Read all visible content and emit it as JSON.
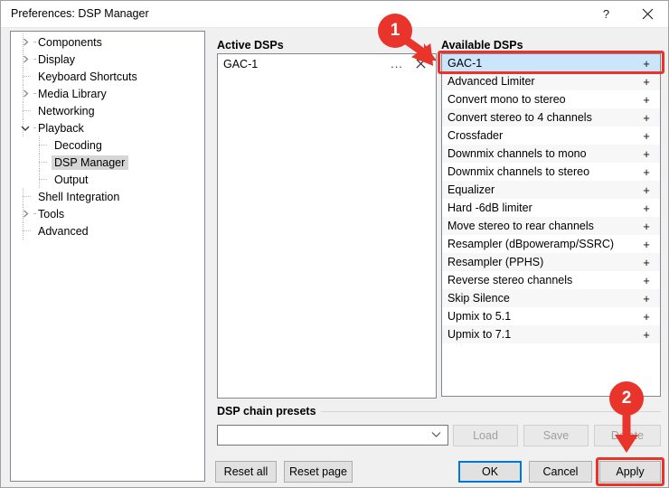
{
  "window": {
    "title": "Preferences: DSP Manager",
    "help_icon": "question-mark-icon",
    "help_label": "?",
    "close_icon": "close-icon"
  },
  "sidebar": {
    "items": [
      {
        "label": "Components",
        "level": 0,
        "marker": "collapsed",
        "selected": false
      },
      {
        "label": "Display",
        "level": 0,
        "marker": "collapsed",
        "selected": false
      },
      {
        "label": "Keyboard Shortcuts",
        "level": 0,
        "marker": "leaf",
        "selected": false
      },
      {
        "label": "Media Library",
        "level": 0,
        "marker": "collapsed",
        "selected": false
      },
      {
        "label": "Networking",
        "level": 0,
        "marker": "leaf",
        "selected": false
      },
      {
        "label": "Playback",
        "level": 0,
        "marker": "expanded",
        "selected": false
      },
      {
        "label": "Decoding",
        "level": 1,
        "marker": "leaf",
        "selected": false
      },
      {
        "label": "DSP Manager",
        "level": 1,
        "marker": "leaf",
        "selected": true
      },
      {
        "label": "Output",
        "level": 1,
        "marker": "leaf",
        "selected": false
      },
      {
        "label": "Shell Integration",
        "level": 0,
        "marker": "leaf",
        "selected": false
      },
      {
        "label": "Tools",
        "level": 0,
        "marker": "collapsed",
        "selected": false
      },
      {
        "label": "Advanced",
        "level": 0,
        "marker": "leaf",
        "selected": false
      }
    ]
  },
  "active_dsps": {
    "heading": "Active DSPs",
    "rows": [
      {
        "label": "GAC-1",
        "config_icon": "ellipsis-icon",
        "config_label": "...",
        "remove_icon": "close-icon",
        "remove_label": "✕"
      }
    ]
  },
  "available_dsps": {
    "heading": "Available DSPs",
    "add_label": "+",
    "rows": [
      {
        "label": "GAC-1",
        "selected": true
      },
      {
        "label": "Advanced Limiter",
        "selected": false
      },
      {
        "label": "Convert mono to stereo",
        "selected": false
      },
      {
        "label": "Convert stereo to 4 channels",
        "selected": false
      },
      {
        "label": "Crossfader",
        "selected": false
      },
      {
        "label": "Downmix channels to mono",
        "selected": false
      },
      {
        "label": "Downmix channels to stereo",
        "selected": false
      },
      {
        "label": "Equalizer",
        "selected": false
      },
      {
        "label": "Hard -6dB limiter",
        "selected": false
      },
      {
        "label": "Move stereo to rear channels",
        "selected": false
      },
      {
        "label": "Resampler (dBpoweramp/SSRC)",
        "selected": false
      },
      {
        "label": "Resampler (PPHS)",
        "selected": false
      },
      {
        "label": "Reverse stereo channels",
        "selected": false
      },
      {
        "label": "Skip Silence",
        "selected": false
      },
      {
        "label": "Upmix to 5.1",
        "selected": false
      },
      {
        "label": "Upmix to 7.1",
        "selected": false
      }
    ]
  },
  "presets": {
    "group_label": "DSP chain presets",
    "combo_value": "",
    "combo_placeholder": "",
    "chevron_icon": "chevron-down-icon",
    "load_label": "Load",
    "save_label": "Save",
    "delete_label": "Delete"
  },
  "footer": {
    "reset_all_label": "Reset all",
    "reset_page_label": "Reset page",
    "ok_label": "OK",
    "cancel_label": "Cancel",
    "apply_label": "Apply"
  },
  "annotations": {
    "badge_1": "1",
    "badge_2": "2",
    "highlight_color": "#e8342a"
  }
}
